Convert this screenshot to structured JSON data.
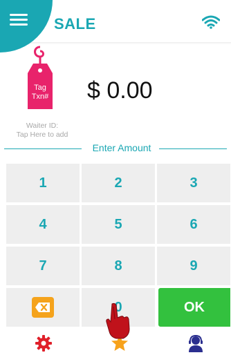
{
  "header": {
    "title": "SALE",
    "menu_icon": "hamburger-menu-icon",
    "status_icon": "wifi-icon"
  },
  "tag": {
    "line1": "Tag",
    "line2": "Txn#",
    "icon": "price-tag-icon"
  },
  "amount": "$ 0.00",
  "waiter": {
    "line1": "Waiter ID:",
    "line2": "Tap Here to add"
  },
  "enter_amount_label": "Enter Amount",
  "keypad": {
    "keys": [
      "1",
      "2",
      "3",
      "4",
      "5",
      "6",
      "7",
      "8",
      "9"
    ],
    "zero": "0",
    "ok": "OK",
    "backspace_icon": "backspace-icon"
  },
  "bottom_nav": {
    "settings_icon": "gear-icon",
    "favorites_icon": "star-icon",
    "support_icon": "support-agent-icon"
  },
  "colors": {
    "accent": "#1aa7b3",
    "tag": "#e8236b",
    "ok": "#33c13e",
    "backspace": "#f5a31c",
    "gear": "#e0202a",
    "star": "#f7a21b",
    "support": "#2b2f8f"
  }
}
